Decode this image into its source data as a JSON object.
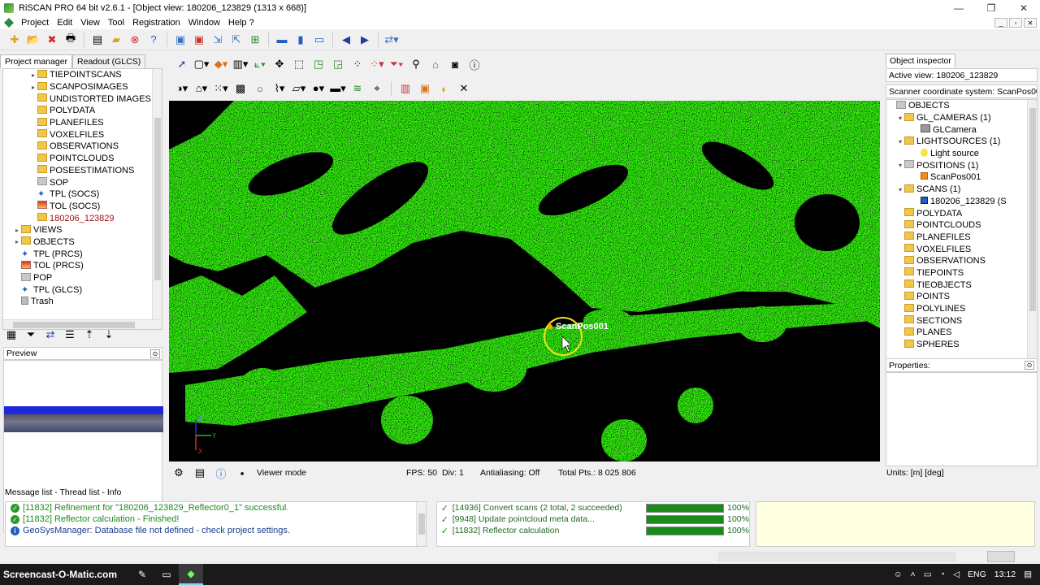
{
  "window": {
    "title": "RiSCAN PRO 64 bit v2.6.1 - [Object view: 180206_123829 (1313 x 668)]"
  },
  "menu": [
    "Project",
    "Edit",
    "View",
    "Tool",
    "Registration",
    "Window",
    "Help ?"
  ],
  "left_tabs": [
    "Project manager",
    "Readout (GLCS)"
  ],
  "project_tree": [
    {
      "label": "TIEPOINTSCANS",
      "indent": 3,
      "exp": "▸",
      "icon": "fold"
    },
    {
      "label": "SCANPOSIMAGES",
      "indent": 3,
      "exp": "▸",
      "icon": "fold"
    },
    {
      "label": "UNDISTORTED IMAGES",
      "indent": 3,
      "exp": "",
      "icon": "fold"
    },
    {
      "label": "POLYDATA",
      "indent": 3,
      "exp": "",
      "icon": "fold"
    },
    {
      "label": "PLANEFILES",
      "indent": 3,
      "exp": "",
      "icon": "fold"
    },
    {
      "label": "VOXELFILES",
      "indent": 3,
      "exp": "",
      "icon": "fold"
    },
    {
      "label": "OBSERVATIONS",
      "indent": 3,
      "exp": "",
      "icon": "fold"
    },
    {
      "label": "POINTCLOUDS",
      "indent": 3,
      "exp": "",
      "icon": "fold"
    },
    {
      "label": "POSEESTIMATIONS",
      "indent": 3,
      "exp": "",
      "icon": "fold"
    },
    {
      "label": "SOP",
      "indent": 3,
      "exp": "",
      "icon": "grey"
    },
    {
      "label": "TPL (SOCS)",
      "indent": 3,
      "exp": "",
      "icon": "tpl"
    },
    {
      "label": "TOL (SOCS)",
      "indent": 3,
      "exp": "",
      "icon": "tol"
    },
    {
      "label": "180206_123829",
      "indent": 3,
      "exp": "",
      "icon": "scan",
      "selected": true
    },
    {
      "label": "VIEWS",
      "indent": 1,
      "exp": "▸",
      "icon": "fold"
    },
    {
      "label": "OBJECTS",
      "indent": 1,
      "exp": "▸",
      "icon": "fold"
    },
    {
      "label": "TPL (PRCS)",
      "indent": 1,
      "exp": "",
      "icon": "tpl"
    },
    {
      "label": "TOL (PRCS)",
      "indent": 1,
      "exp": "",
      "icon": "tol"
    },
    {
      "label": "POP",
      "indent": 1,
      "exp": "",
      "icon": "grey"
    },
    {
      "label": "TPL (GLCS)",
      "indent": 1,
      "exp": "",
      "icon": "tpl"
    },
    {
      "label": "Trash",
      "indent": 1,
      "exp": "",
      "icon": "trash"
    }
  ],
  "preview": {
    "title": "Preview"
  },
  "viewer": {
    "scan_label": "ScanPos001",
    "axis_x": "X",
    "axis_y": "Y",
    "axis_z": "Z"
  },
  "status": {
    "mode": "Viewer mode",
    "fps": "FPS: 50",
    "div": "Div: 1",
    "antialiasing": "Antialiasing: Off",
    "total_pts": "Total Pts.: 8 025 806"
  },
  "inspector": {
    "tab": "Object inspector",
    "active_view": "Active view: 180206_123829",
    "scs": "Scanner coordinate system: ScanPos001",
    "tree": [
      {
        "label": "OBJECTS",
        "indent": 0,
        "exp": "",
        "icon": "grey"
      },
      {
        "label": "GL_CAMERAS (1)",
        "indent": 1,
        "exp": "▾",
        "icon": "fold"
      },
      {
        "label": "GLCamera",
        "indent": 3,
        "exp": "",
        "icon": "cam"
      },
      {
        "label": "LIGHTSOURCES (1)",
        "indent": 1,
        "exp": "▾",
        "icon": "fold"
      },
      {
        "label": "Light source",
        "indent": 3,
        "exp": "",
        "icon": "light"
      },
      {
        "label": "POSITIONS (1)",
        "indent": 1,
        "exp": "▾",
        "icon": "grey"
      },
      {
        "label": "ScanPos001",
        "indent": 3,
        "exp": "",
        "icon": "orange"
      },
      {
        "label": "SCANS (1)",
        "indent": 1,
        "exp": "▾",
        "icon": "fold"
      },
      {
        "label": "180206_123829 (S",
        "indent": 3,
        "exp": "",
        "icon": "blue"
      },
      {
        "label": "POLYDATA",
        "indent": 1,
        "exp": "",
        "icon": "fold"
      },
      {
        "label": "POINTCLOUDS",
        "indent": 1,
        "exp": "",
        "icon": "fold"
      },
      {
        "label": "PLANEFILES",
        "indent": 1,
        "exp": "",
        "icon": "fold"
      },
      {
        "label": "VOXELFILES",
        "indent": 1,
        "exp": "",
        "icon": "fold"
      },
      {
        "label": "OBSERVATIONS",
        "indent": 1,
        "exp": "",
        "icon": "fold"
      },
      {
        "label": "TIEPOINTS",
        "indent": 1,
        "exp": "",
        "icon": "fold"
      },
      {
        "label": "TIEOBJECTS",
        "indent": 1,
        "exp": "",
        "icon": "fold"
      },
      {
        "label": "POINTS",
        "indent": 1,
        "exp": "",
        "icon": "fold"
      },
      {
        "label": "POLYLINES",
        "indent": 1,
        "exp": "",
        "icon": "fold"
      },
      {
        "label": "SECTIONS",
        "indent": 1,
        "exp": "",
        "icon": "fold"
      },
      {
        "label": "PLANES",
        "indent": 1,
        "exp": "",
        "icon": "fold"
      },
      {
        "label": "SPHERES",
        "indent": 1,
        "exp": "",
        "icon": "fold"
      }
    ],
    "properties": "Properties:",
    "units": "Units: [m] [deg]"
  },
  "message_tabs": "Message list - Thread list - Info",
  "messages": [
    {
      "type": "ok",
      "text": "[11832] Refinement for \"180206_123829_Reflector0_1\" successful."
    },
    {
      "type": "ok",
      "text": "[11832] Reflector calculation - Finished!"
    },
    {
      "type": "info",
      "text": "GeoSysManager: Database file not defined - check project settings."
    }
  ],
  "tasks": [
    {
      "label": "[14936] Convert scans (2 total, 2 succeeded)",
      "progress": 100,
      "pct": "100%"
    },
    {
      "label": "[9948] Update pointcloud meta data...",
      "progress": 100,
      "pct": "100%"
    },
    {
      "label": "[11832] Reflector calculation",
      "progress": 100,
      "pct": "100%"
    }
  ],
  "taskbar": {
    "brand": "Screencast-O-Matic.com",
    "lang": "ENG",
    "time": "13:12"
  },
  "colors": {
    "pointcloud": "#33ee11",
    "selected_text": "#a01010",
    "marker": "#f2e21a"
  }
}
